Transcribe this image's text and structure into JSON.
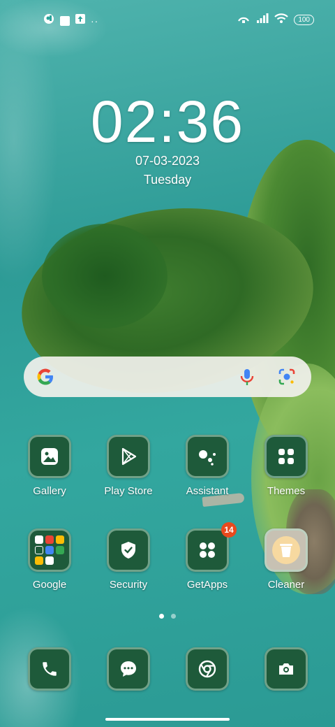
{
  "status_bar": {
    "left_icons": [
      "app-notification-icon",
      "square-notification-icon",
      "upload-icon",
      "more-dots-icon"
    ],
    "right_icons": [
      "hotspot-icon",
      "signal-icon",
      "wifi-icon"
    ],
    "battery": "100"
  },
  "clock": {
    "time": "02:36",
    "date": "07-03-2023",
    "day": "Tuesday"
  },
  "search": {
    "icons": [
      "google-g-icon",
      "mic-icon",
      "lens-icon"
    ]
  },
  "apps_row1": [
    {
      "label": "Gallery",
      "icon": "gallery-icon"
    },
    {
      "label": "Play Store",
      "icon": "play-store-icon"
    },
    {
      "label": "Assistant",
      "icon": "assistant-icon"
    },
    {
      "label": "Themes",
      "icon": "themes-icon"
    }
  ],
  "apps_row2": [
    {
      "label": "Google",
      "icon": "google-folder-icon"
    },
    {
      "label": "Security",
      "icon": "security-icon"
    },
    {
      "label": "GetApps",
      "icon": "getapps-icon",
      "badge": "14"
    },
    {
      "label": "Cleaner",
      "icon": "cleaner-icon"
    }
  ],
  "dock": [
    {
      "icon": "phone-icon"
    },
    {
      "icon": "messages-icon"
    },
    {
      "icon": "chrome-icon"
    },
    {
      "icon": "camera-icon"
    }
  ],
  "page_indicator": {
    "pages": 2,
    "current": 1
  },
  "colors": {
    "tile": "#1e5a3a",
    "badge": "#e8491d"
  }
}
